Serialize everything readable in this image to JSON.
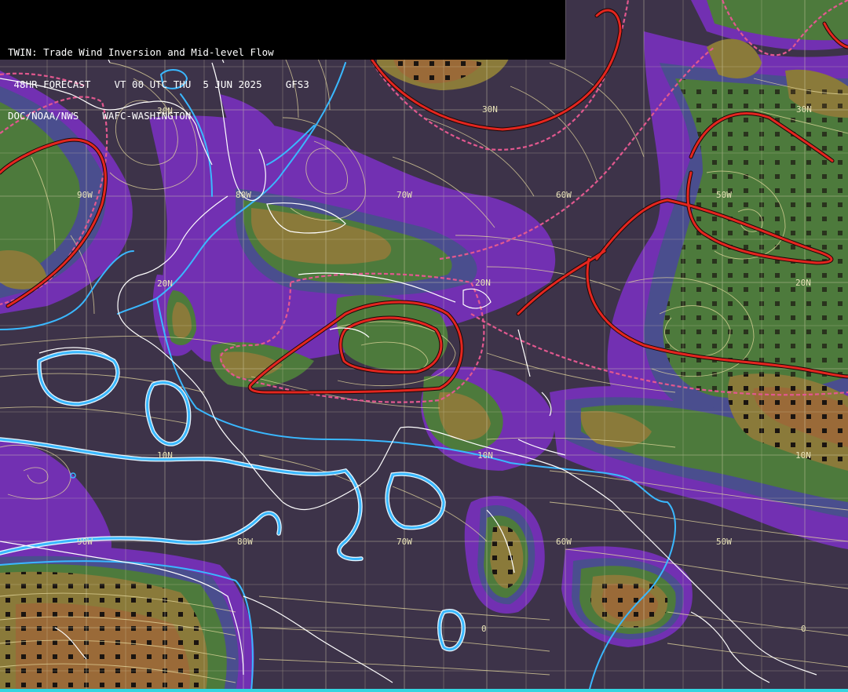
{
  "header": {
    "line1": "TWIN: Trade Wind Inversion and Mid-level Flow",
    "line2": " 48HR FORECAST    VT 00 UTC THU  5 JUN 2025    GFS3",
    "line3": "DOC/NOAA/NWS    WAFC-WASHINGTON"
  },
  "grid_labels": {
    "lat": [
      "30N",
      "30N",
      "20N",
      "20N",
      "20N",
      "20N",
      "10N",
      "10N",
      "10N",
      "0",
      "0"
    ],
    "lon": [
      "90W",
      "80W",
      "70W",
      "60W",
      "50W",
      "90W",
      "80W",
      "70W",
      "60W",
      "50W"
    ]
  },
  "colors": {
    "background": "#3d3349",
    "purple_band": "#7530b8",
    "slate_band": "#4a4e8e",
    "green_band": "#4d7a3c",
    "olive_band": "#8a7a3a",
    "brown_band": "#9a6a38",
    "inversion_contour": "#e3261f",
    "dashed_contour": "#e2588f",
    "cyan_contour": "#3ab8ff",
    "streamline": "#e8dca0",
    "coastline": "#ffffff",
    "grid": "#d9d3b0"
  },
  "map": {
    "region": "Caribbean / Gulf of Mexico / Tropical Atlantic",
    "layers": [
      "trade wind inversion base shading",
      "mid-level streamlines",
      "inversion contours",
      "coastlines",
      "lat/lon grid"
    ]
  }
}
